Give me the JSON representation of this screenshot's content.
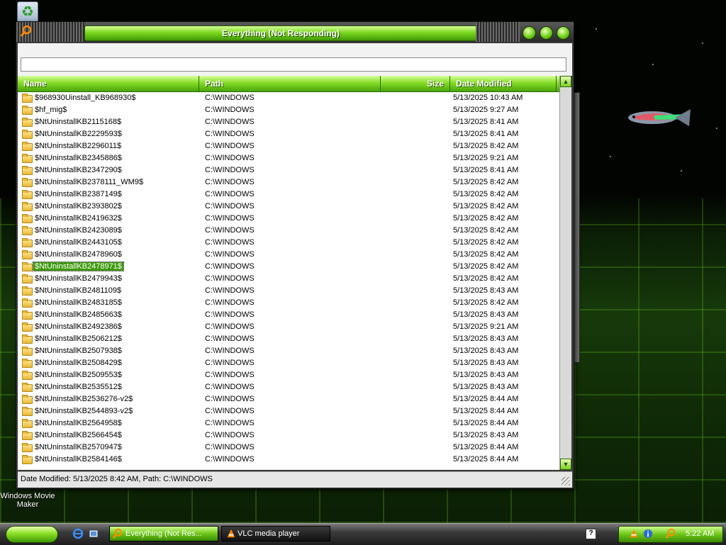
{
  "window": {
    "title": "Everything (Not Responding)"
  },
  "search": {
    "value": "",
    "placeholder": ""
  },
  "columns": [
    {
      "label": "Name"
    },
    {
      "label": "Path"
    },
    {
      "label": "Size"
    },
    {
      "label": "Date Modified"
    }
  ],
  "rows": [
    {
      "name": "$968930Uinstall_KB968930$",
      "path": "C:\\WINDOWS",
      "size": "",
      "date": "5/13/2025 10:43 AM"
    },
    {
      "name": "$hf_mig$",
      "path": "C:\\WINDOWS",
      "size": "",
      "date": "5/13/2025 9:27 AM"
    },
    {
      "name": "$NtUninstallKB2115168$",
      "path": "C:\\WINDOWS",
      "size": "",
      "date": "5/13/2025 8:41 AM"
    },
    {
      "name": "$NtUninstallKB2229593$",
      "path": "C:\\WINDOWS",
      "size": "",
      "date": "5/13/2025 8:41 AM"
    },
    {
      "name": "$NtUninstallKB2296011$",
      "path": "C:\\WINDOWS",
      "size": "",
      "date": "5/13/2025 8:42 AM"
    },
    {
      "name": "$NtUninstallKB2345886$",
      "path": "C:\\WINDOWS",
      "size": "",
      "date": "5/13/2025 9:21 AM"
    },
    {
      "name": "$NtUninstallKB2347290$",
      "path": "C:\\WINDOWS",
      "size": "",
      "date": "5/13/2025 8:41 AM"
    },
    {
      "name": "$NtUninstallKB2378111_WM9$",
      "path": "C:\\WINDOWS",
      "size": "",
      "date": "5/13/2025 8:42 AM"
    },
    {
      "name": "$NtUninstallKB2387149$",
      "path": "C:\\WINDOWS",
      "size": "",
      "date": "5/13/2025 8:42 AM"
    },
    {
      "name": "$NtUninstallKB2393802$",
      "path": "C:\\WINDOWS",
      "size": "",
      "date": "5/13/2025 8:42 AM"
    },
    {
      "name": "$NtUninstallKB2419632$",
      "path": "C:\\WINDOWS",
      "size": "",
      "date": "5/13/2025 8:42 AM"
    },
    {
      "name": "$NtUninstallKB2423089$",
      "path": "C:\\WINDOWS",
      "size": "",
      "date": "5/13/2025 8:42 AM"
    },
    {
      "name": "$NtUninstallKB2443105$",
      "path": "C:\\WINDOWS",
      "size": "",
      "date": "5/13/2025 8:42 AM"
    },
    {
      "name": "$NtUninstallKB2478960$",
      "path": "C:\\WINDOWS",
      "size": "",
      "date": "5/13/2025 8:42 AM"
    },
    {
      "name": "$NtUninstallKB2478971$",
      "path": "C:\\WINDOWS",
      "size": "",
      "date": "5/13/2025 8:42 AM",
      "selected": true
    },
    {
      "name": "$NtUninstallKB2479943$",
      "path": "C:\\WINDOWS",
      "size": "",
      "date": "5/13/2025 8:42 AM"
    },
    {
      "name": "$NtUninstallKB2481109$",
      "path": "C:\\WINDOWS",
      "size": "",
      "date": "5/13/2025 8:43 AM"
    },
    {
      "name": "$NtUninstallKB2483185$",
      "path": "C:\\WINDOWS",
      "size": "",
      "date": "5/13/2025 8:42 AM"
    },
    {
      "name": "$NtUninstallKB2485663$",
      "path": "C:\\WINDOWS",
      "size": "",
      "date": "5/13/2025 8:43 AM"
    },
    {
      "name": "$NtUninstallKB2492386$",
      "path": "C:\\WINDOWS",
      "size": "",
      "date": "5/13/2025 9:21 AM"
    },
    {
      "name": "$NtUninstallKB2506212$",
      "path": "C:\\WINDOWS",
      "size": "",
      "date": "5/13/2025 8:43 AM"
    },
    {
      "name": "$NtUninstallKB2507938$",
      "path": "C:\\WINDOWS",
      "size": "",
      "date": "5/13/2025 8:43 AM"
    },
    {
      "name": "$NtUninstallKB2508429$",
      "path": "C:\\WINDOWS",
      "size": "",
      "date": "5/13/2025 8:43 AM"
    },
    {
      "name": "$NtUninstallKB2509553$",
      "path": "C:\\WINDOWS",
      "size": "",
      "date": "5/13/2025 8:43 AM"
    },
    {
      "name": "$NtUninstallKB2535512$",
      "path": "C:\\WINDOWS",
      "size": "",
      "date": "5/13/2025 8:43 AM"
    },
    {
      "name": "$NtUninstallKB2536276-v2$",
      "path": "C:\\WINDOWS",
      "size": "",
      "date": "5/13/2025 8:44 AM"
    },
    {
      "name": "$NtUninstallKB2544893-v2$",
      "path": "C:\\WINDOWS",
      "size": "",
      "date": "5/13/2025 8:44 AM"
    },
    {
      "name": "$NtUninstallKB2564958$",
      "path": "C:\\WINDOWS",
      "size": "",
      "date": "5/13/2025 8:44 AM"
    },
    {
      "name": "$NtUninstallKB2566454$",
      "path": "C:\\WINDOWS",
      "size": "",
      "date": "5/13/2025 8:43 AM"
    },
    {
      "name": "$NtUninstallKB2570947$",
      "path": "C:\\WINDOWS",
      "size": "",
      "date": "5/13/2025 8:44 AM"
    },
    {
      "name": "$NtUninstallKB2584146$",
      "path": "C:\\WINDOWS",
      "size": "",
      "date": "5/13/2025 8:44 AM"
    }
  ],
  "status": {
    "text": "Date Modified: 5/13/2025 8:42 AM, Path: C:\\WINDOWS"
  },
  "desktop": {
    "icons": [
      {
        "label": "Windows Movie Maker"
      }
    ]
  },
  "taskbar": {
    "buttons": [
      {
        "label": "Everything (Not Res...",
        "active": true,
        "icon": "search-icon"
      },
      {
        "label": "VLC media player",
        "active": false,
        "icon": "vlc-cone-icon"
      }
    ],
    "clock": "5:22 AM"
  },
  "colors": {
    "accent_green": "#7cd81e",
    "selection": "#3d9a0c",
    "chrome_dark": "#2a2a2a"
  }
}
